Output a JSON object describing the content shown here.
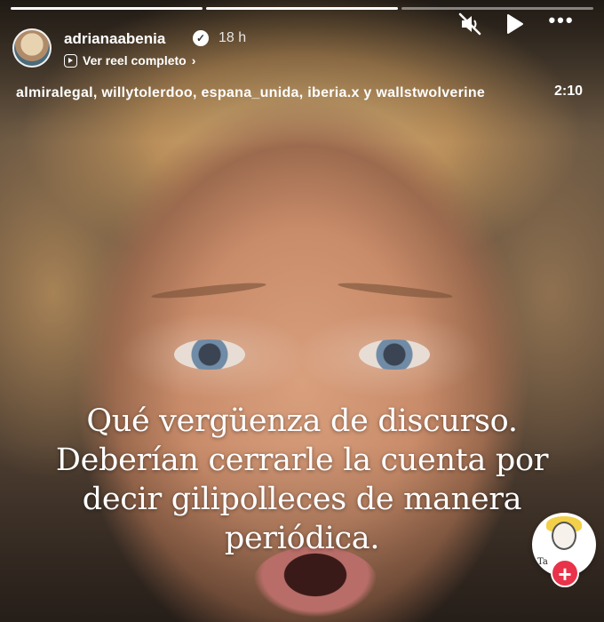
{
  "story": {
    "username": "adrianaabenia",
    "verified": true,
    "time_ago": "18 h",
    "reel_link_label": "Ver reel completo",
    "mentions": "almiralegal, willytolerdoo, espana_unida, iberia.x y wallstwolverine",
    "duration": "2:10",
    "caption": "Qué vergüenza de discurso. Deberían cerrarle la cuenta por decir gilipolleces de manera periódica.",
    "progress": {
      "segments": 3,
      "current_index": 1,
      "current_progress": 1.0
    }
  },
  "controls": {
    "mute_icon": "speaker-muted-icon",
    "play_icon": "play-icon",
    "more_icon": "more-dots-icon",
    "more_glyph": "•••",
    "chevron_glyph": "›"
  },
  "sticker": {
    "icon": "avatar-sticker-icon",
    "text": "Ta",
    "add_glyph": "+"
  },
  "colors": {
    "add_button": "#e8334a",
    "text": "#ffffff"
  }
}
